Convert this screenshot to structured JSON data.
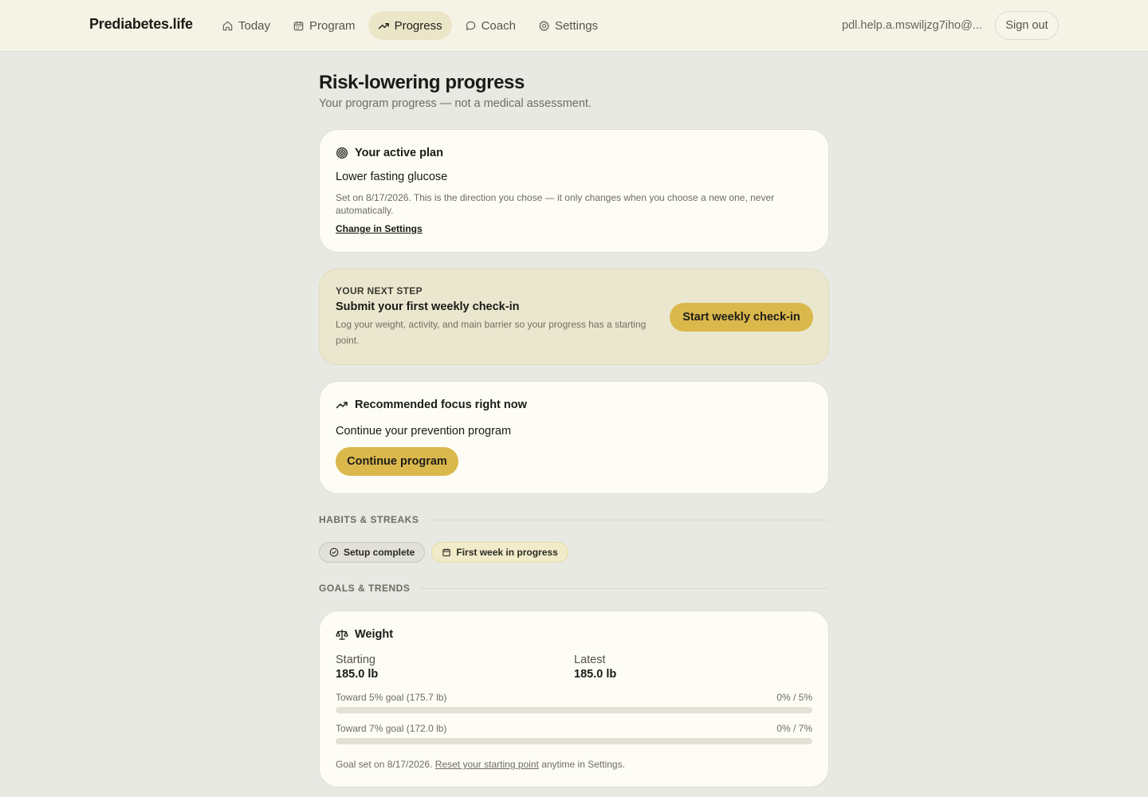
{
  "header": {
    "brand": "Prediabetes.life",
    "nav": [
      {
        "label": "Today",
        "icon": "home-icon"
      },
      {
        "label": "Program",
        "icon": "calendar-icon"
      },
      {
        "label": "Progress",
        "icon": "trending-up-icon",
        "active": true
      },
      {
        "label": "Coach",
        "icon": "chat-icon"
      },
      {
        "label": "Settings",
        "icon": "gear-icon"
      }
    ],
    "user_email": "pdl.help.a.mswiljzg7iho@...",
    "sign_out_label": "Sign out"
  },
  "page": {
    "title": "Risk-lowering progress",
    "subtitle": "Your program progress — not a medical assessment."
  },
  "active_plan": {
    "heading": "Your active plan",
    "icon": "target-icon",
    "plan_name": "Lower fasting glucose",
    "note": "Set on 8/17/2026. This is the direction you chose — it only changes when you choose a new one, never automatically.",
    "link_label": "Change in Settings"
  },
  "next_step": {
    "kicker": "YOUR NEXT STEP",
    "title": "Submit your first weekly check-in",
    "description": "Log your weight, activity, and main barrier so your progress has a starting point.",
    "button_label": "Start weekly check-in"
  },
  "focus": {
    "heading": "Recommended focus right now",
    "icon": "trending-up-icon",
    "text": "Continue your prevention program",
    "button_label": "Continue program"
  },
  "habits": {
    "section_label": "HABITS & STREAKS",
    "chips": [
      {
        "label": "Setup complete",
        "icon": "check-circle-icon"
      },
      {
        "label": "First week in progress",
        "icon": "calendar-icon"
      }
    ]
  },
  "goals": {
    "section_label": "GOALS & TRENDS",
    "weight": {
      "heading": "Weight",
      "icon": "scale-icon",
      "starting_label": "Starting",
      "starting_value": "185.0 lb",
      "latest_label": "Latest",
      "latest_value": "185.0 lb",
      "goal5_label": "Toward 5% goal (175.7 lb)",
      "goal5_value": "0% / 5%",
      "goal5_progress": 0,
      "goal7_label": "Toward 7% goal (172.0 lb)",
      "goal7_value": "0% / 7%",
      "goal7_progress": 0,
      "footer_prefix": "Goal set on 8/17/2026.",
      "footer_link": "Reset your starting point",
      "footer_suffix": "anytime in Settings."
    }
  },
  "colors": {
    "accent": "#dbb84c",
    "background": "#e8e9e3",
    "card": "#fdfcf5",
    "next_step_bg": "#ebe7cf"
  }
}
